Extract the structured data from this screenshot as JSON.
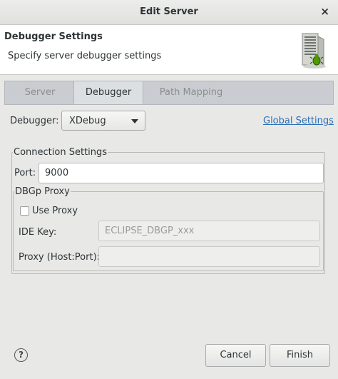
{
  "window": {
    "title": "Edit Server",
    "close_glyph": "×"
  },
  "banner": {
    "heading": "Debugger Settings",
    "description": "Specify server debugger settings",
    "icon": "server-bug-icon"
  },
  "tabs": [
    {
      "label": "Server",
      "active": false
    },
    {
      "label": "Debugger",
      "active": true
    },
    {
      "label": "Path Mapping",
      "active": false
    }
  ],
  "debugger": {
    "label": "Debugger:",
    "selected": "XDebug",
    "global_settings_link": "Global Settings"
  },
  "connection": {
    "legend": "Connection Settings",
    "port_label": "Port:",
    "port_value": "9000"
  },
  "proxy": {
    "legend": "DBGp Proxy",
    "use_proxy_label": "Use Proxy",
    "use_proxy_checked": false,
    "ide_key_label": "IDE Key:",
    "ide_key_value": "ECLIPSE_DBGP_xxx",
    "host_port_label": "Proxy (Host:Port):",
    "host_port_value": ""
  },
  "footer": {
    "help_glyph": "?",
    "cancel_label": "Cancel",
    "finish_label": "Finish"
  }
}
